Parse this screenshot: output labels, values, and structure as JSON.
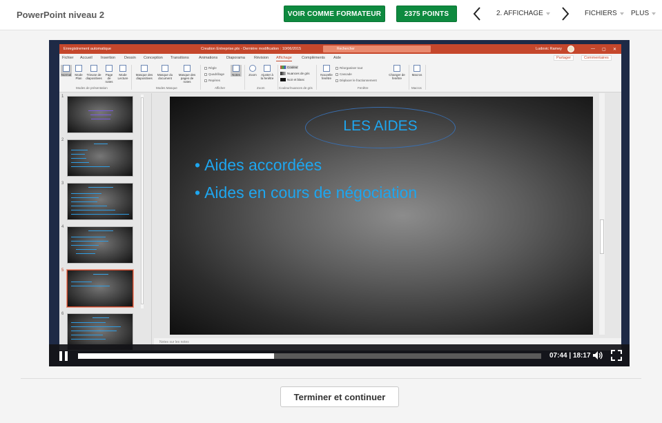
{
  "header": {
    "course_title": "PowerPoint niveau 2",
    "trainer_button": "VOIR COMME FORMATEUR",
    "points_button": "2375 POINTS",
    "section_label": "2. AFFICHAGE",
    "files_label": "FICHIERS",
    "more_label": "PLUS"
  },
  "powerpoint": {
    "autosave": "Enregistrement automatique",
    "doc_title": "Creation Entreprise.ptx  -  Dernière modification : 10/06/2015",
    "search_placeholder": "Rechercher",
    "user_name": "Ludovic Ramey",
    "tabs": [
      "Fichier",
      "Accueil",
      "Insertion",
      "Dessin",
      "Conception",
      "Transitions",
      "Animations",
      "Diaporama",
      "Révision",
      "Affichage",
      "Compléments",
      "Aide"
    ],
    "active_tab": "Affichage",
    "share": "Partager",
    "comments": "Commentaires",
    "ribbon": {
      "items": [
        "Normal",
        "Mode Plan",
        "Trieuse de diapositives",
        "Page de notes",
        "Mode Lecture",
        "Masque des diapositives",
        "Masque du document",
        "Masque des pages de notes",
        "Notes",
        "Zoom",
        "Ajuster à la fenêtre",
        "Nouvelle fenêtre",
        "Changer de fenêtre",
        "Macros"
      ],
      "checks": [
        "Règle",
        "Quadrillage",
        "Repères"
      ],
      "color_options": [
        "Couleur",
        "Nuances de gris",
        "Noir et blanc"
      ],
      "window_options": [
        "Réorganiser tout",
        "Cascade",
        "Déplacer le fractionnement"
      ],
      "groups": [
        "Modes de présentation",
        "Modes Masque",
        "Afficher",
        "Zoom",
        "Couleur/nuances de gris",
        "Fenêtre",
        "Macros"
      ]
    },
    "thumbnails": [
      "1",
      "2",
      "3",
      "4",
      "5",
      "6"
    ],
    "current_slide": 5,
    "slide": {
      "title": "LES AIDES",
      "bullets": [
        "Aides accordées",
        "Aides en cours de négociation"
      ]
    },
    "notes_placeholder": "Notes sur les notes"
  },
  "player": {
    "current_time": "07:44",
    "duration": "18:17",
    "time_separator": " | ",
    "progress_fraction": 0.423
  },
  "footer": {
    "finish_button": "Terminer et continuer"
  },
  "colors": {
    "brand_green": "#0e8a3f",
    "ppt_accent": "#c5472c",
    "slide_text": "#1ea6ef"
  }
}
